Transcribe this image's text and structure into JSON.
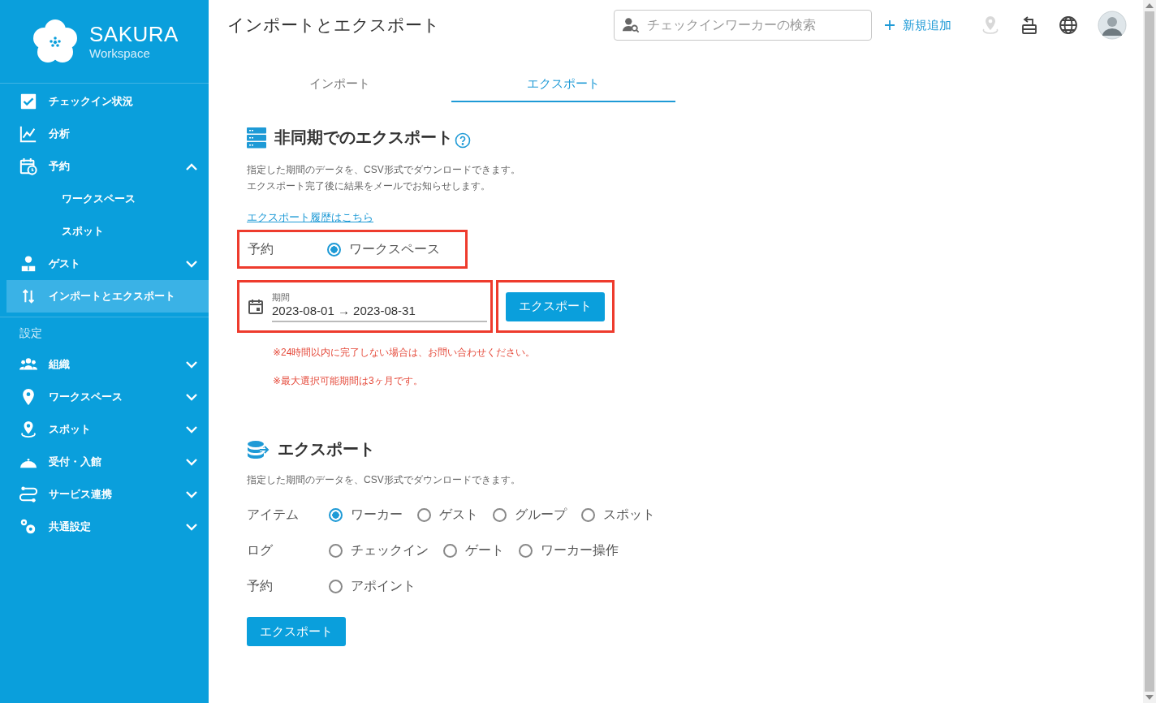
{
  "sidebar": {
    "logo": {
      "title": "SAKURA",
      "subtitle": "Workspace"
    },
    "items": [
      {
        "kind": "link",
        "label": "チェックイン状況",
        "selected": false
      },
      {
        "kind": "link",
        "label": "分析",
        "selected": false
      },
      {
        "kind": "group",
        "label": "予約",
        "selected": false,
        "expanded": true,
        "children": [
          {
            "label": "ワークスペース",
            "selected": false
          },
          {
            "label": "スポット",
            "selected": false
          }
        ]
      },
      {
        "kind": "group",
        "label": "ゲスト",
        "selected": false,
        "expanded": false
      },
      {
        "kind": "link",
        "label": "インポートとエクスポート",
        "selected": true
      }
    ],
    "settings": {
      "heading": "設定",
      "items": [
        {
          "label": "組織",
          "selected": false,
          "expanded": false
        },
        {
          "label": "ワークスペース",
          "selected": false,
          "expanded": false
        },
        {
          "label": "スポット",
          "selected": false,
          "expanded": false
        },
        {
          "label": "受付・入館",
          "selected": false,
          "expanded": false
        },
        {
          "label": "サービス連携",
          "selected": false,
          "expanded": false
        },
        {
          "label": "共通設定",
          "selected": false,
          "expanded": false
        }
      ]
    }
  },
  "header": {
    "title": "インポートとエクスポート",
    "search": {
      "placeholder": "チェックインワーカーの検索"
    },
    "add_link": "新規追加"
  },
  "tabs": [
    {
      "label": "インポート",
      "selected": false
    },
    {
      "label": "エクスポート",
      "selected": true
    }
  ],
  "async_export": {
    "title": "非同期でのエクスポート",
    "description": [
      "指定した期間のデータを、CSV形式でダウンロードできます。",
      "エクスポート完了後に結果をメールでお知らせします。"
    ],
    "history_link": "エクスポート履歴はこちら",
    "reserve": {
      "label": "予約",
      "highlighted": true,
      "options": [
        {
          "label": "ワークスペース",
          "selected": true
        }
      ]
    },
    "period": {
      "label": "期間",
      "value": "2023-08-01 → 2023-08-31",
      "highlighted": true
    },
    "button": {
      "label": "エクスポート",
      "highlighted": true
    },
    "notes": [
      "※24時間以内に完了しない場合は、お問い合わせください。",
      "※最大選択可能期間は3ヶ月です。"
    ]
  },
  "export": {
    "title": "エクスポート",
    "description": "指定した期間のデータを、CSV形式でダウンロードできます。",
    "groups": [
      {
        "label": "アイテム",
        "options": [
          {
            "label": "ワーカー",
            "selected": true
          },
          {
            "label": "ゲスト",
            "selected": false
          },
          {
            "label": "グループ",
            "selected": false
          },
          {
            "label": "スポット",
            "selected": false
          }
        ]
      },
      {
        "label": "ログ",
        "options": [
          {
            "label": "チェックイン",
            "selected": false
          },
          {
            "label": "ゲート",
            "selected": false
          },
          {
            "label": "ワーカー操作",
            "selected": false
          }
        ]
      },
      {
        "label": "予約",
        "options": [
          {
            "label": "アポイント",
            "selected": false
          }
        ]
      }
    ],
    "button": "エクスポート"
  }
}
